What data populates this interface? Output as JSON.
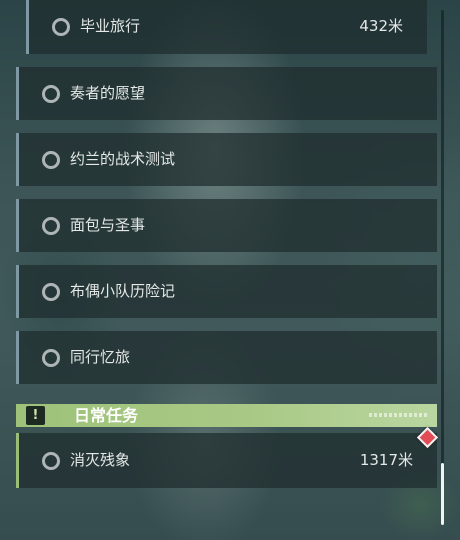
{
  "quests": [
    {
      "label": "毕业旅行",
      "distance": "432米"
    },
    {
      "label": "奏者的愿望"
    },
    {
      "label": "约兰的战术测试"
    },
    {
      "label": "面包与圣事"
    },
    {
      "label": "布偶小队历险记"
    },
    {
      "label": "同行忆旅"
    }
  ],
  "daily_section": {
    "title": "日常任务",
    "icon": "exclamation-box-icon",
    "quest": {
      "label": "消灭残象",
      "distance": "1317米"
    }
  },
  "colors": {
    "accent_green": "#a8c985",
    "tracked_marker": "#e24c55"
  }
}
